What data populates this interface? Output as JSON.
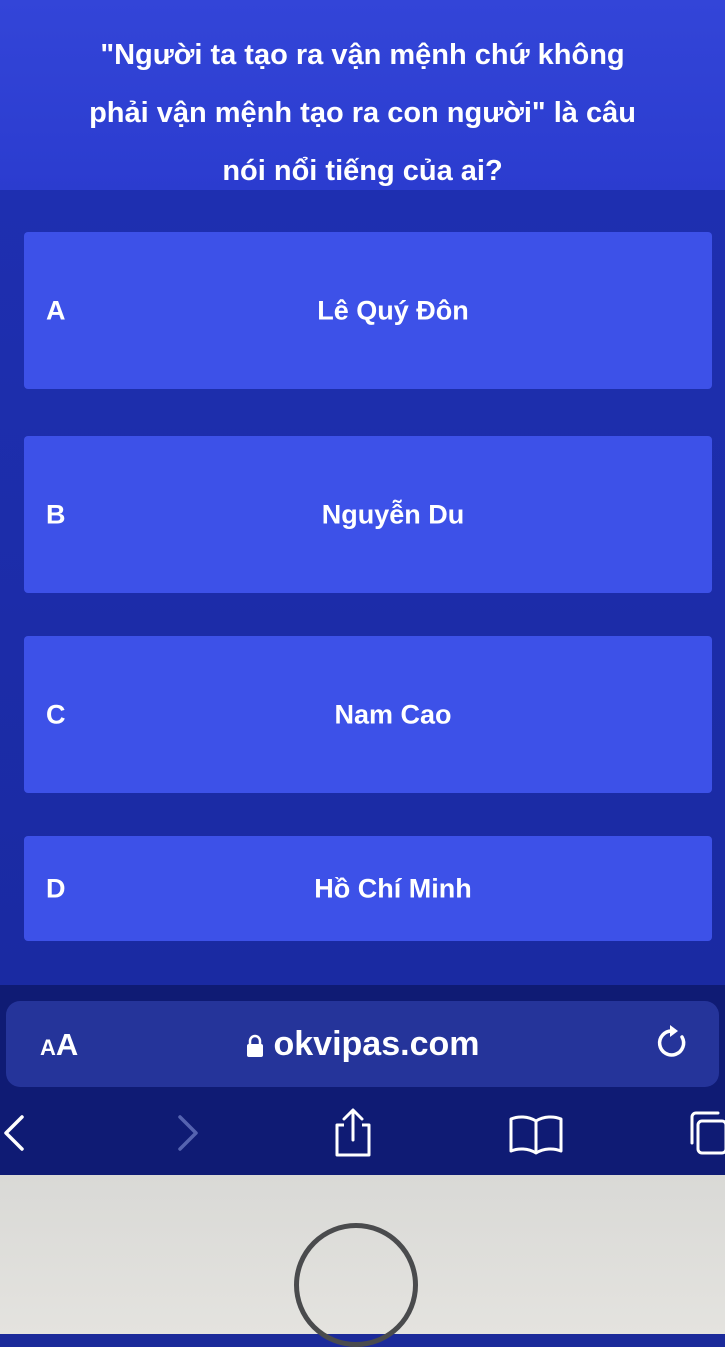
{
  "question": {
    "line1": "\"Người ta tạo ra vận mệnh chứ không",
    "line2": "phải vận mệnh tạo ra con người\" là câu",
    "line3": "nói nổi tiếng của ai?"
  },
  "answers": [
    {
      "letter": "A",
      "text": "Lê Quý Đôn"
    },
    {
      "letter": "B",
      "text": "Nguyễn Du"
    },
    {
      "letter": "C",
      "text": "Nam Cao"
    },
    {
      "letter": "D",
      "text": "Hồ Chí Minh"
    }
  ],
  "browser": {
    "text_size_small": "A",
    "text_size_large": "A",
    "url": "okvipas.com",
    "icons": [
      "lock-icon",
      "reload-icon",
      "back-icon",
      "forward-icon",
      "share-icon",
      "bookmarks-icon",
      "tabs-icon"
    ]
  }
}
